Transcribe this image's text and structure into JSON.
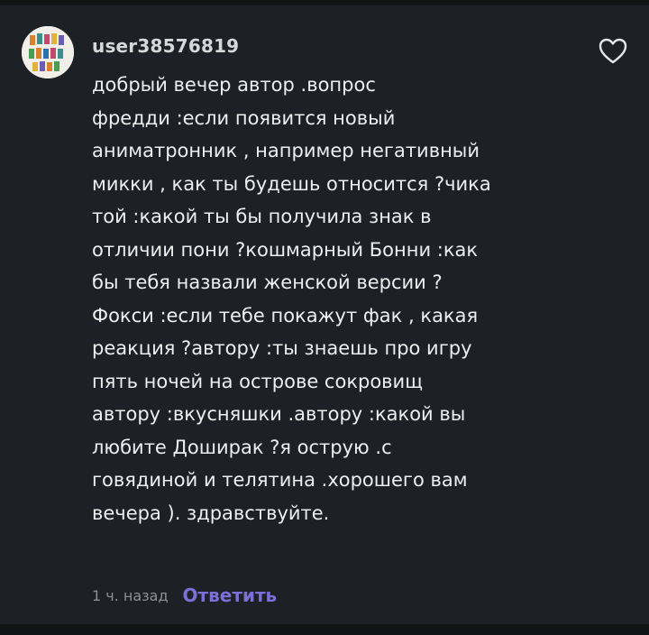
{
  "comment": {
    "author": "user38576819",
    "text": "добрый вечер автор .вопрос\nфредди :если появится новый\nаниматронник , например негативный\nмикки , как ты будешь относится ?чика\nтой :какой ты бы получила знак в\nотличии пони ?кошмарный Бонни :как\nбы тебя назвали женской версии ?\nФокси :если тебе покажут фак , какая\nреакция ?автору :ты знаешь про игру\nпять ночей на острове сокровищ\nавтору :вкусняшки .автору :какой вы\nлюбите Доширак ?я острую .с\nговядиной и телятина .хорошего вам\nвечера ). здравствуйте.",
    "timestamp": "1 ч. назад",
    "reply_label": "Ответить",
    "like_icon": "heart-outline-icon"
  },
  "colors": {
    "background": "#1d2024",
    "text": "#eceef0",
    "muted": "#8d9196",
    "accent": "#7c70d8"
  }
}
